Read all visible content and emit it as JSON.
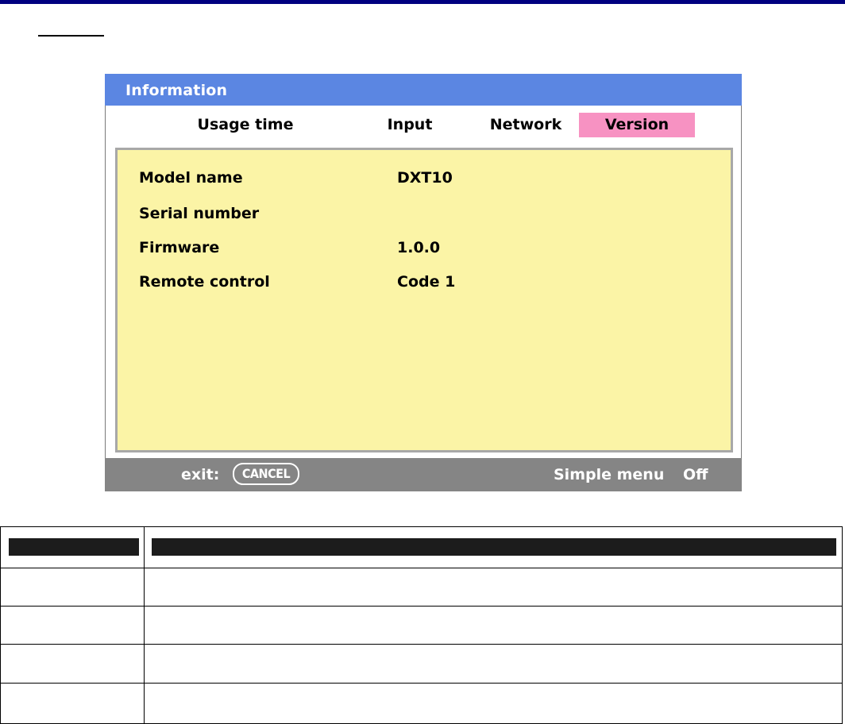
{
  "osd": {
    "title": "Information",
    "tabs": [
      {
        "label": "Usage time",
        "selected": false
      },
      {
        "label": "Input",
        "selected": false
      },
      {
        "label": "Network",
        "selected": false
      },
      {
        "label": "Version",
        "selected": true
      }
    ],
    "rows": [
      {
        "label": "Model name",
        "value": "DXT10"
      },
      {
        "label": "Serial number",
        "value": ""
      },
      {
        "label": "Firmware",
        "value": "1.0.0"
      },
      {
        "label": "Remote control",
        "value": "Code 1"
      }
    ],
    "footer": {
      "exit_label": "exit:",
      "cancel_key": "CANCEL",
      "simple_menu_label": "Simple menu",
      "simple_menu_value": "Off"
    }
  },
  "colors": {
    "title_bar": "#5b86e2",
    "selected_tab": "#f792c2",
    "content_bg": "#fbf4a6",
    "footer_bg": "#858585",
    "top_rule": "#000080"
  }
}
